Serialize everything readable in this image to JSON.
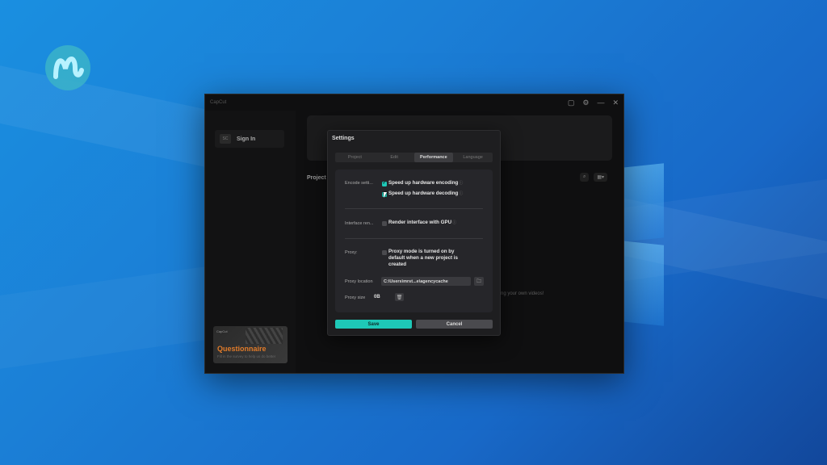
{
  "app": {
    "title": "CapCut",
    "signin_label": "Sign In",
    "avatar_text": "SC",
    "projects_label": "Project",
    "empty_hint": "ng your own videos!",
    "promo": {
      "brand": "CapCut",
      "title": "Questionnaire",
      "subtitle": "Fill in the survey to help us do better"
    }
  },
  "settings": {
    "title": "Settings",
    "tabs": [
      {
        "label": "Project",
        "active": false
      },
      {
        "label": "Edit",
        "active": false
      },
      {
        "label": "Performance",
        "active": true
      },
      {
        "label": "Language",
        "active": false
      }
    ],
    "encode": {
      "label": "Encode setti...",
      "hw_encoding": {
        "label": "Speed up hardware encoding",
        "checked": true
      },
      "hw_decoding": {
        "label": "Speed up hardware decoding",
        "checked": true
      }
    },
    "interface": {
      "label": "Interface ren...",
      "gpu": {
        "label": "Render interface with GPU",
        "checked": false
      }
    },
    "proxy": {
      "label": "Proxy:",
      "mode_line1": "Proxy mode is turned on by",
      "mode_line2": "default when a new project is",
      "mode_line3": "created",
      "checked": false,
      "location_label": "Proxy location",
      "location_value": "C:\\Users\\mrst...e\\agencycache",
      "size_label": "Proxy size",
      "size_value": "0B"
    },
    "save_label": "Save",
    "cancel_label": "Cancel"
  },
  "colors": {
    "accent": "#1ec8b7",
    "modal_bg": "#1e1e20",
    "app_bg": "#0f0f10",
    "desktop": "#1b7fd6"
  },
  "icons": [
    "feedback-icon",
    "settings-icon",
    "minimize-icon",
    "close-icon",
    "search-icon",
    "grid-view-icon",
    "folder-icon",
    "trash-icon",
    "help-icon"
  ]
}
